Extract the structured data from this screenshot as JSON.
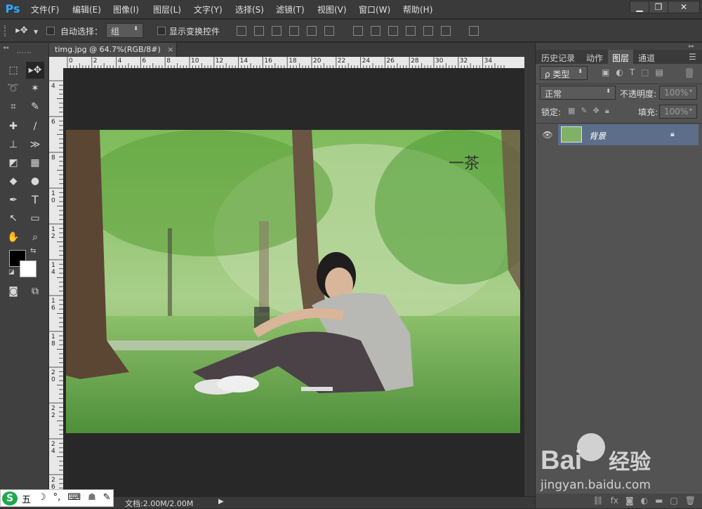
{
  "app": {
    "logo": "Ps"
  },
  "menu": [
    "文件(F)",
    "编辑(E)",
    "图像(I)",
    "图层(L)",
    "文字(Y)",
    "选择(S)",
    "滤镜(T)",
    "视图(V)",
    "窗口(W)",
    "帮助(H)"
  ],
  "window_controls": {
    "minimize": "▁",
    "restore": "❐",
    "close": "✕"
  },
  "options": {
    "auto_select_label": "自动选择：",
    "group_value": "组",
    "show_transform_label": "显示变换控件"
  },
  "document": {
    "tab_title": "timg.jpg @ 64.7%(RGB/8#)",
    "tab_close": "×"
  },
  "ruler_top": [
    "0",
    "2",
    "4",
    "6",
    "8",
    "10",
    "12",
    "14",
    "16",
    "18",
    "20",
    "22",
    "24",
    "26",
    "28",
    "30",
    "32",
    "34"
  ],
  "ruler_left": [
    "4",
    "6",
    "8",
    "1 0",
    "1 2",
    "1 4",
    "1 6",
    "1 8",
    "2 0",
    "2 2",
    "2 4",
    "2 6"
  ],
  "photo": {
    "overlay_text": "一茶"
  },
  "panels": {
    "tabs": [
      "历史记录",
      "动作",
      "图层",
      "通道"
    ],
    "filter_kind": "ρ 类型",
    "blend_mode": "正常",
    "opacity_label": "不透明度:",
    "opacity_value": "100%",
    "lock_label": "锁定:",
    "fill_label": "填充:",
    "fill_value": "100%",
    "layers": [
      {
        "name": "背景"
      }
    ]
  },
  "status": {
    "doc_info": "文档:2.00M/2.00M"
  },
  "ime": {
    "items": [
      "五",
      "☽",
      "°,",
      "⌨",
      "☗",
      "✎"
    ]
  },
  "watermark": {
    "line1": "Bai",
    "line1b": "经验",
    "line2": "jingyan.baidu.com"
  },
  "colors": {
    "ps_blue": "#31a8ff",
    "layer_selected": "#5c6e89",
    "baidu_red": "#e1251b",
    "baidu_blue": "#2e59c4"
  }
}
